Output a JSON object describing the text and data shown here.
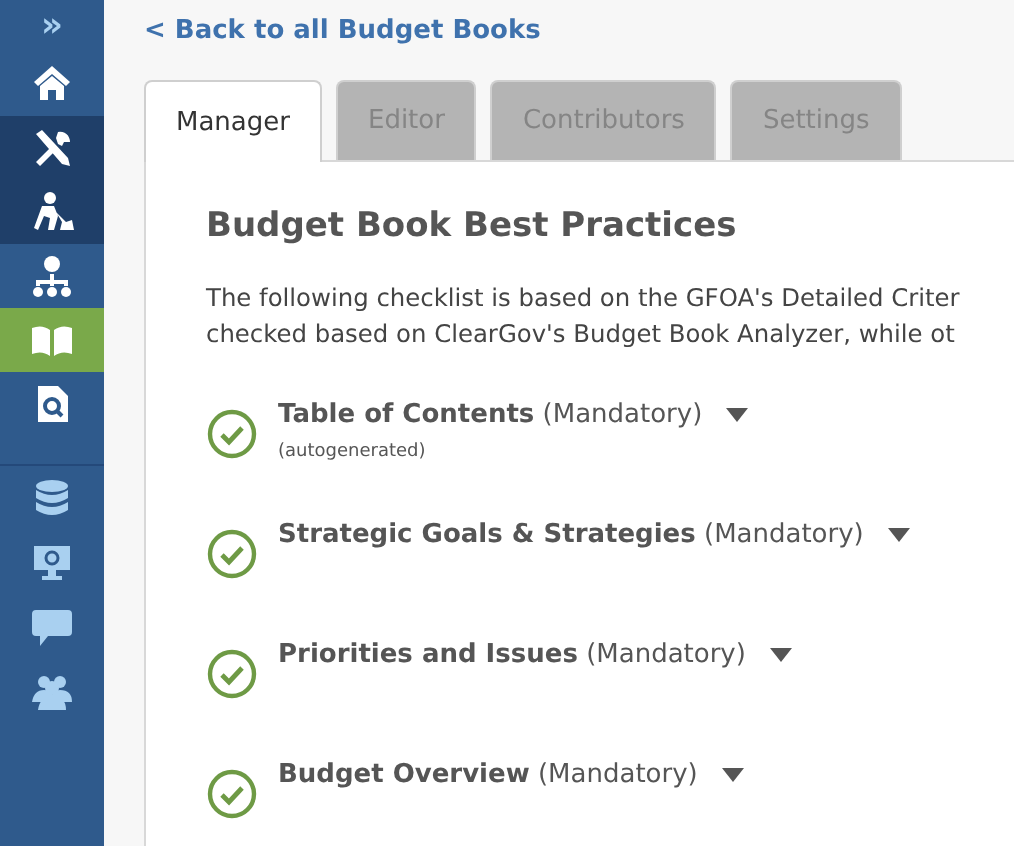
{
  "sidebar": {
    "toggle": "»",
    "items": [
      {
        "kind": "home",
        "selected": false,
        "active": false
      },
      {
        "kind": "tools",
        "selected": false,
        "active": true
      },
      {
        "kind": "worker",
        "selected": false,
        "active": true
      },
      {
        "kind": "org",
        "selected": false,
        "active": false
      },
      {
        "kind": "book",
        "selected": true,
        "active": false
      },
      {
        "kind": "doc-search",
        "selected": false,
        "active": false
      }
    ],
    "secondary_items": [
      {
        "kind": "database"
      },
      {
        "kind": "monitor"
      },
      {
        "kind": "chat"
      },
      {
        "kind": "users"
      }
    ]
  },
  "back_link": "< Back to all Budget Books",
  "tabs": [
    {
      "label": "Manager",
      "selected": true
    },
    {
      "label": "Editor",
      "selected": false
    },
    {
      "label": "Contributors",
      "selected": false
    },
    {
      "label": "Settings",
      "selected": false
    }
  ],
  "panel": {
    "heading": "Budget Book Best Practices",
    "description_lines": [
      "The following checklist is based on the GFOA's Detailed Criter",
      "checked based on ClearGov's Budget Book Analyzer, while ot"
    ],
    "checklist": [
      {
        "title": "Table of Contents",
        "tag": "(Mandatory)",
        "note": "(autogenerated)",
        "checked": true
      },
      {
        "title": "Strategic Goals & Strategies",
        "tag": "(Mandatory)",
        "checked": true
      },
      {
        "title": "Priorities and Issues",
        "tag": "(Mandatory)",
        "checked": true
      },
      {
        "title": "Budget Overview",
        "tag": "(Mandatory)",
        "checked": true
      }
    ]
  }
}
